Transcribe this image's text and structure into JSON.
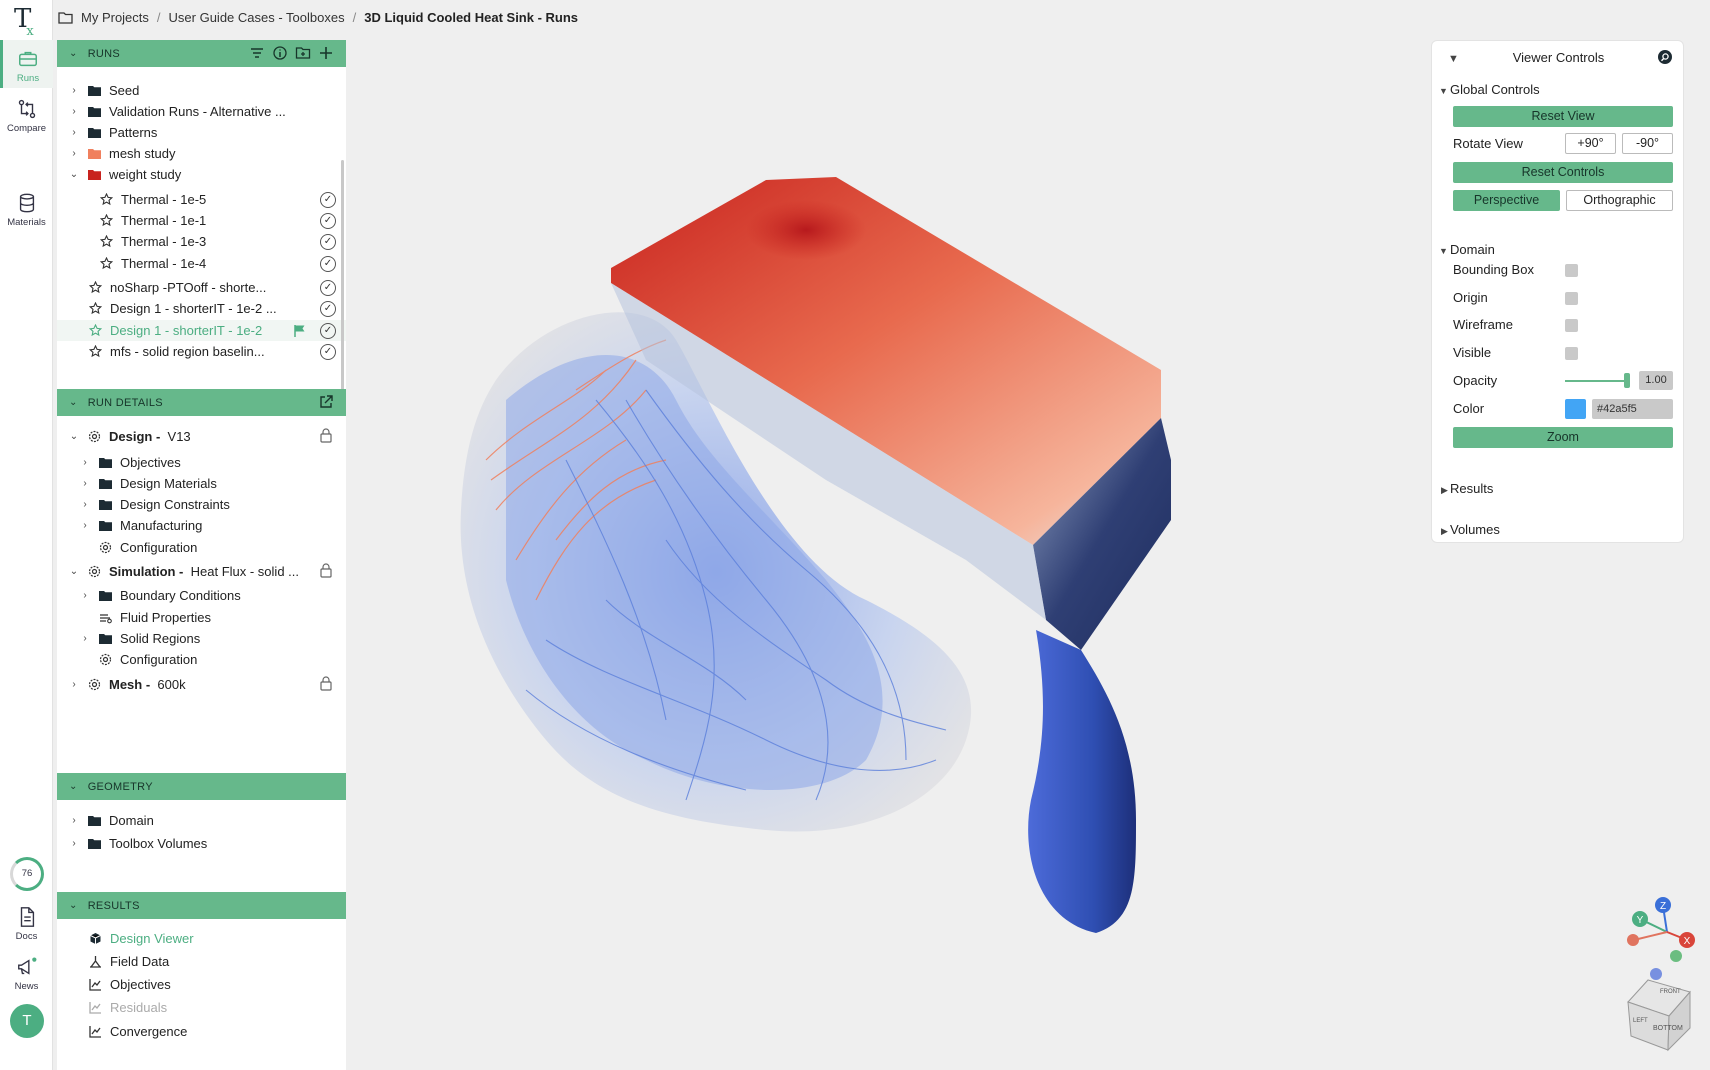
{
  "breadcrumb": {
    "items": [
      "My Projects",
      "User Guide Cases - Toolboxes",
      "3D Liquid Cooled Heat Sink - Runs"
    ],
    "separator": "/"
  },
  "rail": {
    "logo": "T",
    "logo_sub": "x",
    "runs": "Runs",
    "compare": "Compare",
    "materials": "Materials",
    "progress": "76",
    "docs": "Docs",
    "news": "News",
    "avatar": "T"
  },
  "runs_section": {
    "title": "RUNS",
    "items": [
      {
        "label": "Seed",
        "icon": "folder-icon"
      },
      {
        "label": "Validation Runs - Alternative ...",
        "icon": "folder-icon"
      },
      {
        "label": "Patterns",
        "icon": "folder-icon"
      },
      {
        "label": "mesh study",
        "icon": "folder-orange-icon"
      },
      {
        "label": "weight study",
        "icon": "folder-red-icon"
      },
      {
        "label": "Thermal - 1e-5",
        "icon": "star-icon"
      },
      {
        "label": "Thermal - 1e-1",
        "icon": "star-icon"
      },
      {
        "label": "Thermal - 1e-3",
        "icon": "star-icon"
      },
      {
        "label": "Thermal - 1e-4",
        "icon": "star-icon"
      },
      {
        "label": "noSharp -PTOoff - shorte...",
        "icon": "star-icon"
      },
      {
        "label": "Design 1 - shorterIT - 1e-2 ...",
        "icon": "star-icon"
      },
      {
        "label": "Design 1 - shorterIT - 1e-2",
        "icon": "star-icon"
      },
      {
        "label": "mfs - solid region baselin...",
        "icon": "star-icon"
      }
    ]
  },
  "run_details": {
    "title": "RUN DETAILS",
    "design_label": "Design -",
    "design_value": "V13",
    "design_children": [
      "Objectives",
      "Design Materials",
      "Design Constraints",
      "Manufacturing",
      "Configuration"
    ],
    "simulation_label": "Simulation -",
    "simulation_value": "Heat Flux - solid ...",
    "simulation_children": [
      "Boundary Conditions",
      "Fluid Properties",
      "Solid Regions",
      "Configuration"
    ],
    "mesh_label": "Mesh -",
    "mesh_value": "600k"
  },
  "geometry": {
    "title": "GEOMETRY",
    "items": [
      "Domain",
      "Toolbox Volumes"
    ]
  },
  "results": {
    "title": "RESULTS",
    "items": [
      "Design Viewer",
      "Field Data",
      "Objectives",
      "Residuals",
      "Convergence"
    ]
  },
  "viewer_controls": {
    "title": "Viewer Controls",
    "global_controls": "Global Controls",
    "reset_view": "Reset View",
    "rotate_view": "Rotate View",
    "rotate_plus": "+90°",
    "rotate_minus": "-90°",
    "reset_controls": "Reset Controls",
    "perspective": "Perspective",
    "orthographic": "Orthographic",
    "domain": "Domain",
    "bounding_box": "Bounding Box",
    "origin": "Origin",
    "wireframe": "Wireframe",
    "visible": "Visible",
    "opacity": "Opacity",
    "opacity_value": "1.00",
    "color": "Color",
    "color_value": "#42a5f5",
    "zoom": "Zoom",
    "results": "Results",
    "volumes": "Volumes"
  },
  "axes": {
    "x": "X",
    "y": "Y",
    "z": "Z"
  },
  "view_cube": {
    "front": "FRONT",
    "left": "LEFT",
    "bottom": "BOTTOM"
  },
  "colors": {
    "accent": "#66b88b",
    "accent_text": "#4cae82",
    "hot": "#c8231e",
    "cold": "#2f4fb3",
    "swatch": "#42a5f5"
  }
}
